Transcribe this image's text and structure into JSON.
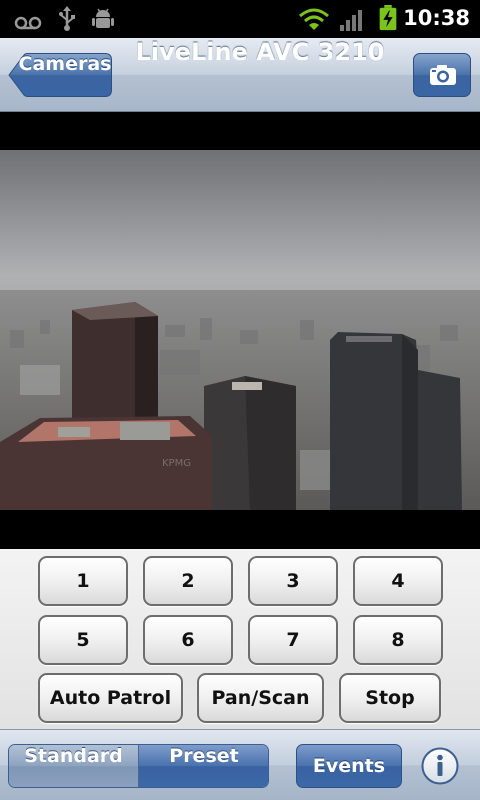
{
  "status_bar": {
    "time": "10:38",
    "icons": [
      "voicemail-icon",
      "usb-icon",
      "android-debug-icon",
      "wifi-icon",
      "signal-icon",
      "battery-charging-icon"
    ]
  },
  "nav": {
    "back_label": "Cameras",
    "title": "LiveLine AVC 3210",
    "snapshot_icon": "camera-icon"
  },
  "controls": {
    "presets": [
      "1",
      "2",
      "3",
      "4",
      "5",
      "6",
      "7",
      "8"
    ],
    "auto_patrol": "Auto Patrol",
    "pan_scan": "Pan/Scan",
    "stop": "Stop"
  },
  "tabbar": {
    "standard": "Standard",
    "preset": "Preset",
    "selected": "Preset",
    "events": "Events",
    "info_icon": "info-icon"
  },
  "colors": {
    "accent_blue": "#3d69a8",
    "nav_bar": "#b4c1d2"
  }
}
